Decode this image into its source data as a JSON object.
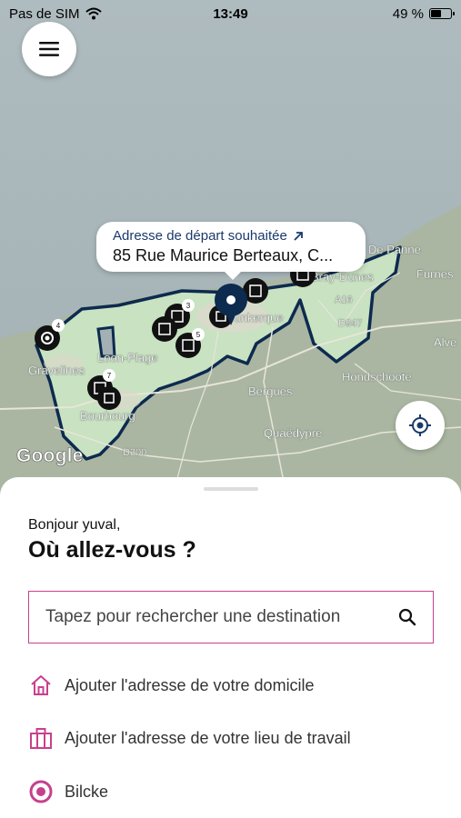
{
  "status_bar": {
    "carrier": "Pas de SIM",
    "time": "13:49",
    "battery": "49 %",
    "battery_level": 0.49
  },
  "map": {
    "callout": {
      "label": "Adresse de départ souhaitée",
      "address": "85 Rue Maurice Berteaux, C..."
    },
    "labels": [
      "Gravelines",
      "Loon-Plage",
      "Bourbourg",
      "Dunkerque",
      "Bergues",
      "Hondschoote",
      "Quaëdypre",
      "Furnes",
      "De Panne",
      "Bray-Dunes",
      "Alve",
      "A16",
      "D947",
      "D300"
    ],
    "pins": [
      {
        "icon": "building-pin-icon",
        "count": "4"
      },
      {
        "icon": "building-pin-icon",
        "count": "7"
      },
      {
        "icon": "building-pin-icon",
        "count": "3"
      },
      {
        "icon": "building-pin-icon",
        "count": "5"
      },
      {
        "icon": "building-pin-icon",
        "count": ""
      }
    ],
    "attribution": "Google"
  },
  "sheet": {
    "greeting": "Bonjour yuval,",
    "title": "Où allez-vous ?",
    "search_placeholder": "Tapez pour rechercher une destination",
    "items": [
      {
        "icon": "home-icon",
        "label": "Ajouter l'adresse de votre domicile"
      },
      {
        "icon": "briefcase-icon",
        "label": "Ajouter l'adresse de votre lieu de travail"
      },
      {
        "icon": "target-place-icon",
        "label": "Bilcke"
      }
    ]
  },
  "colors": {
    "accent": "#c8408d",
    "navy": "#0d2a4f",
    "zone_fill": "#c9e3c4"
  }
}
